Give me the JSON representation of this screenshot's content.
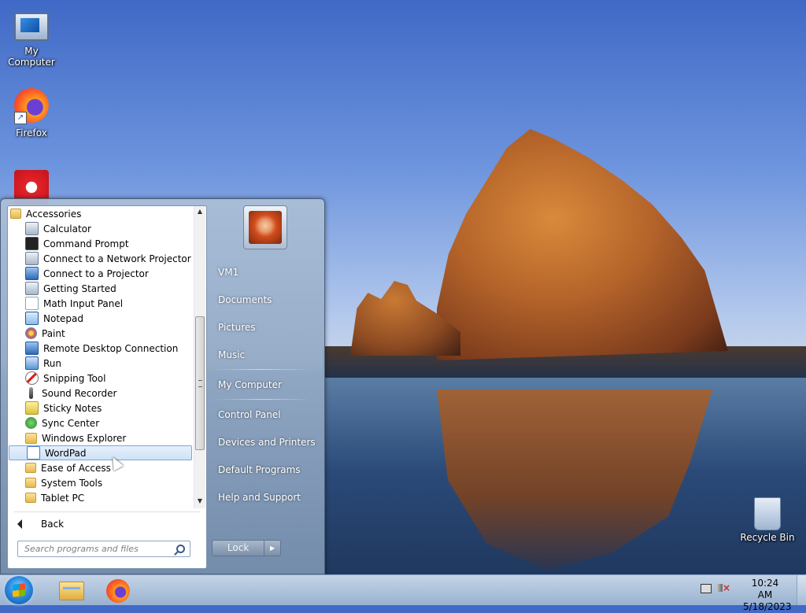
{
  "desktop": {
    "icons": [
      {
        "label": "My Computer"
      },
      {
        "label": "Firefox"
      },
      {
        "label": ""
      },
      {
        "label": "Recycle Bin"
      }
    ]
  },
  "start_menu": {
    "programs": [
      {
        "label": "Accessories",
        "icon": "folder-icon"
      },
      {
        "label": "Calculator",
        "icon": "calculator-icon"
      },
      {
        "label": "Command Prompt",
        "icon": "command-prompt-icon"
      },
      {
        "label": "Connect to a Network Projector",
        "icon": "network-projector-icon"
      },
      {
        "label": "Connect to a Projector",
        "icon": "projector-icon"
      },
      {
        "label": "Getting Started",
        "icon": "getting-started-icon"
      },
      {
        "label": "Math Input Panel",
        "icon": "math-input-icon"
      },
      {
        "label": "Notepad",
        "icon": "notepad-icon"
      },
      {
        "label": "Paint",
        "icon": "paint-icon"
      },
      {
        "label": "Remote Desktop Connection",
        "icon": "remote-desktop-icon"
      },
      {
        "label": "Run",
        "icon": "run-icon"
      },
      {
        "label": "Snipping Tool",
        "icon": "snipping-tool-icon"
      },
      {
        "label": "Sound Recorder",
        "icon": "microphone-icon"
      },
      {
        "label": "Sticky Notes",
        "icon": "sticky-notes-icon"
      },
      {
        "label": "Sync Center",
        "icon": "sync-icon"
      },
      {
        "label": "Windows Explorer",
        "icon": "explorer-icon"
      },
      {
        "label": "WordPad",
        "icon": "wordpad-icon"
      },
      {
        "label": "Ease of Access",
        "icon": "folder-icon"
      },
      {
        "label": "System Tools",
        "icon": "folder-icon"
      },
      {
        "label": "Tablet PC",
        "icon": "folder-icon"
      }
    ],
    "back_label": "Back",
    "search_placeholder": "Search programs and files",
    "right_items": {
      "user": "VM1",
      "documents": "Documents",
      "pictures": "Pictures",
      "music": "Music",
      "computer": "My Computer",
      "control_panel": "Control Panel",
      "devices": "Devices and Printers",
      "default_programs": "Default Programs",
      "help": "Help and Support"
    },
    "lock_label": "Lock"
  },
  "taskbar": {
    "time": "10:24 AM",
    "date": "5/18/2023"
  }
}
